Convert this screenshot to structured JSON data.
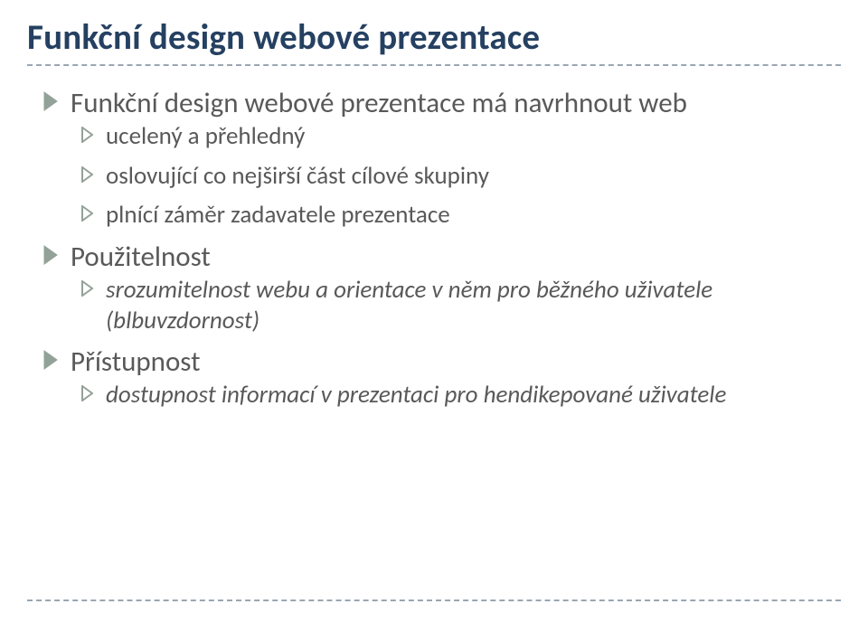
{
  "title": "Funkční design webové prezentace",
  "items": [
    {
      "text": "Funkční design webové prezentace má navrhnout web",
      "children": [
        {
          "text": "ucelený a přehledný"
        },
        {
          "text": "oslovující co nejširší část cílové skupiny"
        },
        {
          "text": "plnící záměr zadavatele prezentace"
        }
      ]
    },
    {
      "text": "Použitelnost",
      "children": [
        {
          "text": "srozumitelnost webu a orientace v něm pro běžného uživatele (blbuvzdornost)"
        }
      ]
    },
    {
      "text": "Přístupnost",
      "children": [
        {
          "text": "dostupnost informací v prezentaci pro hendikepované uživatele"
        }
      ]
    }
  ]
}
